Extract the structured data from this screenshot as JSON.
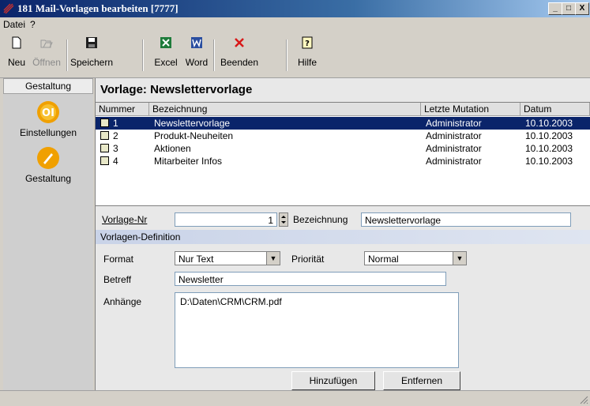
{
  "window": {
    "title": "181 Mail-Vorlagen bearbeiten [7777]",
    "min": "_",
    "max": "□",
    "close": "X"
  },
  "menu": [
    "Datei",
    "?"
  ],
  "toolbar": {
    "new": "Neu",
    "open": "Öffnen",
    "save": "Speichern",
    "excel": "Excel",
    "word": "Word",
    "exit": "Beenden",
    "help": "Hilfe"
  },
  "nav": {
    "header": "Gestaltung",
    "items": [
      "Einstellungen",
      "Gestaltung"
    ]
  },
  "main": {
    "title": "Vorlage: Newslettervorlage",
    "columns": [
      "Nummer",
      "Bezeichnung",
      "Letzte Mutation",
      "Datum"
    ],
    "rows": [
      {
        "nr": "1",
        "name": "Newslettervorlage",
        "mutation": "Administrator",
        "date": "10.10.2003"
      },
      {
        "nr": "2",
        "name": "Produkt-Neuheiten",
        "mutation": "Administrator",
        "date": "10.10.2003"
      },
      {
        "nr": "3",
        "name": "Aktionen",
        "mutation": "Administrator",
        "date": "10.10.2003"
      },
      {
        "nr": "4",
        "name": "Mitarbeiter Infos",
        "mutation": "Administrator",
        "date": "10.10.2003"
      }
    ]
  },
  "form": {
    "vorlage_nr_label": "Vorlage-Nr",
    "vorlage_nr": "1",
    "bezeichnung_label": "Bezeichnung",
    "bezeichnung": "Newslettervorlage",
    "section": "Vorlagen-Definition",
    "format_label": "Format",
    "format": "Nur Text",
    "prioritaet_label": "Priorität",
    "prioritaet": "Normal",
    "betreff_label": "Betreff",
    "betreff": "Newsletter",
    "anhaenge_label": "Anhänge",
    "anhaenge": "D:\\Daten\\CRM\\CRM.pdf",
    "add": "Hinzufügen",
    "remove": "Entfernen"
  },
  "colors": {
    "titlebar": "#0a246a",
    "selection": "#0a246a",
    "nav_icon": "#f0a000"
  },
  "icons": [
    "new-icon",
    "open-icon",
    "save-icon",
    "excel-icon",
    "word-icon",
    "exit-icon",
    "help-icon",
    "settings-icon",
    "design-icon"
  ]
}
